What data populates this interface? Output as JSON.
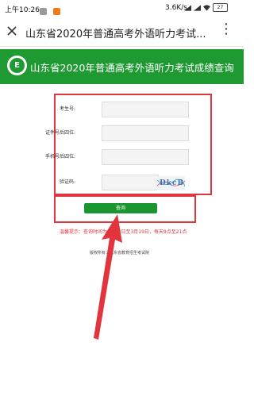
{
  "status_bar": {
    "time": "上午10:26",
    "net_speed": "3.6K/s",
    "battery": "27"
  },
  "title_bar": {
    "title": "山东省2020年普通高考外语听力考试...",
    "more": "⋮"
  },
  "banner": {
    "title": "山东省2020年普通高考外语听力考试成绩查询",
    "logo_text": "E"
  },
  "form": {
    "fields": [
      {
        "label": "考生号:",
        "value": ""
      },
      {
        "label": "证件号后四位:",
        "value": ""
      },
      {
        "label": "手机号后四位:",
        "value": ""
      },
      {
        "label": "验证码:",
        "value": ""
      }
    ],
    "captcha_text": "DkcB"
  },
  "query_button": "查询",
  "tip": "温馨提示：查询时间为3月12日至3月19日，每天9点至21点",
  "copyright": "版权所有：山东省教育招生考试院",
  "colors": {
    "brand_green": "#1f9a33",
    "annotation_red": "#e2343d"
  }
}
